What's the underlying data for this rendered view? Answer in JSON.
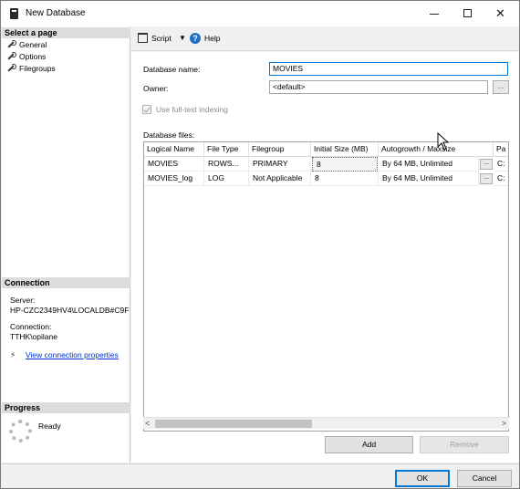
{
  "window": {
    "title": "New Database"
  },
  "left_panel": {
    "select_page_header": "Select a page",
    "pages": [
      {
        "label": "General"
      },
      {
        "label": "Options"
      },
      {
        "label": "Filegroups"
      }
    ],
    "connection_header": "Connection",
    "server_label": "Server:",
    "server_value": "HP-CZC2349HV4\\LOCALDB#C9F",
    "connection_label": "Connection:",
    "connection_value": "TTHK\\opilane",
    "view_connection_link": "View connection properties",
    "progress_header": "Progress",
    "progress_status": "Ready"
  },
  "toolbar": {
    "script_label": "Script",
    "help_label": "Help"
  },
  "general": {
    "database_name_label": "Database name:",
    "database_name_value": "MOVIES",
    "owner_label": "Owner:",
    "owner_value": "<default>",
    "owner_browse": "...",
    "fulltext_label": "Use full-text indexing",
    "fulltext_checked": true,
    "database_files_label": "Database files:"
  },
  "files_grid": {
    "columns": [
      "Logical Name",
      "File Type",
      "Filegroup",
      "Initial Size (MB)",
      "Autogrowth / Maxsize",
      "Pa"
    ],
    "rows": [
      {
        "logical_name": "MOVIES",
        "file_type": "ROWS...",
        "filegroup": "PRIMARY",
        "initial_size": "8",
        "autogrowth": "By 64 MB, Unlimited",
        "browse": "...",
        "path": "C:"
      },
      {
        "logical_name": "MOVIES_log",
        "file_type": "LOG",
        "filegroup": "Not Applicable",
        "initial_size": "8",
        "autogrowth": "By 64 MB, Unlimited",
        "browse": "...",
        "path": "C:"
      }
    ]
  },
  "buttons": {
    "add": "Add",
    "remove": "Remove",
    "ok": "OK",
    "cancel": "Cancel"
  }
}
